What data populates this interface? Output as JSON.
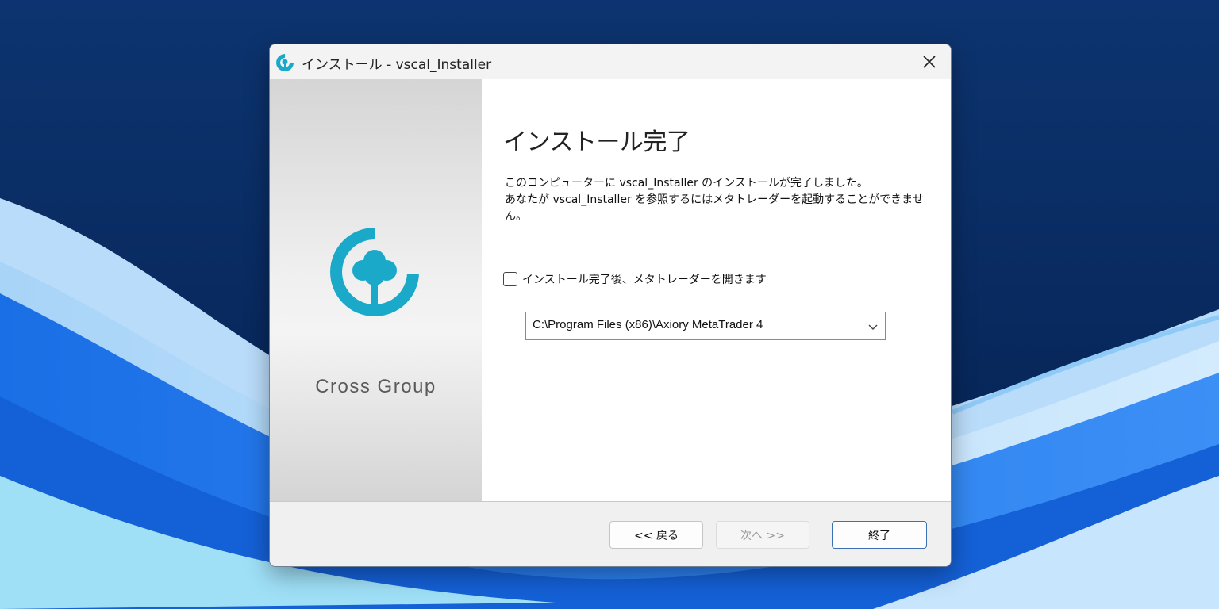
{
  "colors": {
    "accent": "#1aa9c9",
    "desktop_dark": "#0a2a5e",
    "desktop_light": "#bfe1fb",
    "primary_button_border": "#3b6fb6"
  },
  "window": {
    "title": "インストール - vscal_Installer",
    "app_icon": "cross-group-logo-icon",
    "close_icon": "close-icon"
  },
  "sidepanel": {
    "brand": "Cross Group"
  },
  "main": {
    "heading": "インストール完了",
    "description_line1": "このコンピューターに vscal_Installer のインストールが完了しました。",
    "description_line2": "あなたが vscal_Installer を参照するにはメタトレーダーを起動することができません。",
    "checkbox_label": "インストール完了後、メタトレーダーを開きます",
    "checkbox_checked": false,
    "path_select_value": "C:\\Program Files (x86)\\Axiory MetaTrader 4"
  },
  "footer": {
    "back_label": "<< 戻る",
    "next_label": "次へ >>",
    "finish_label": "終了"
  }
}
